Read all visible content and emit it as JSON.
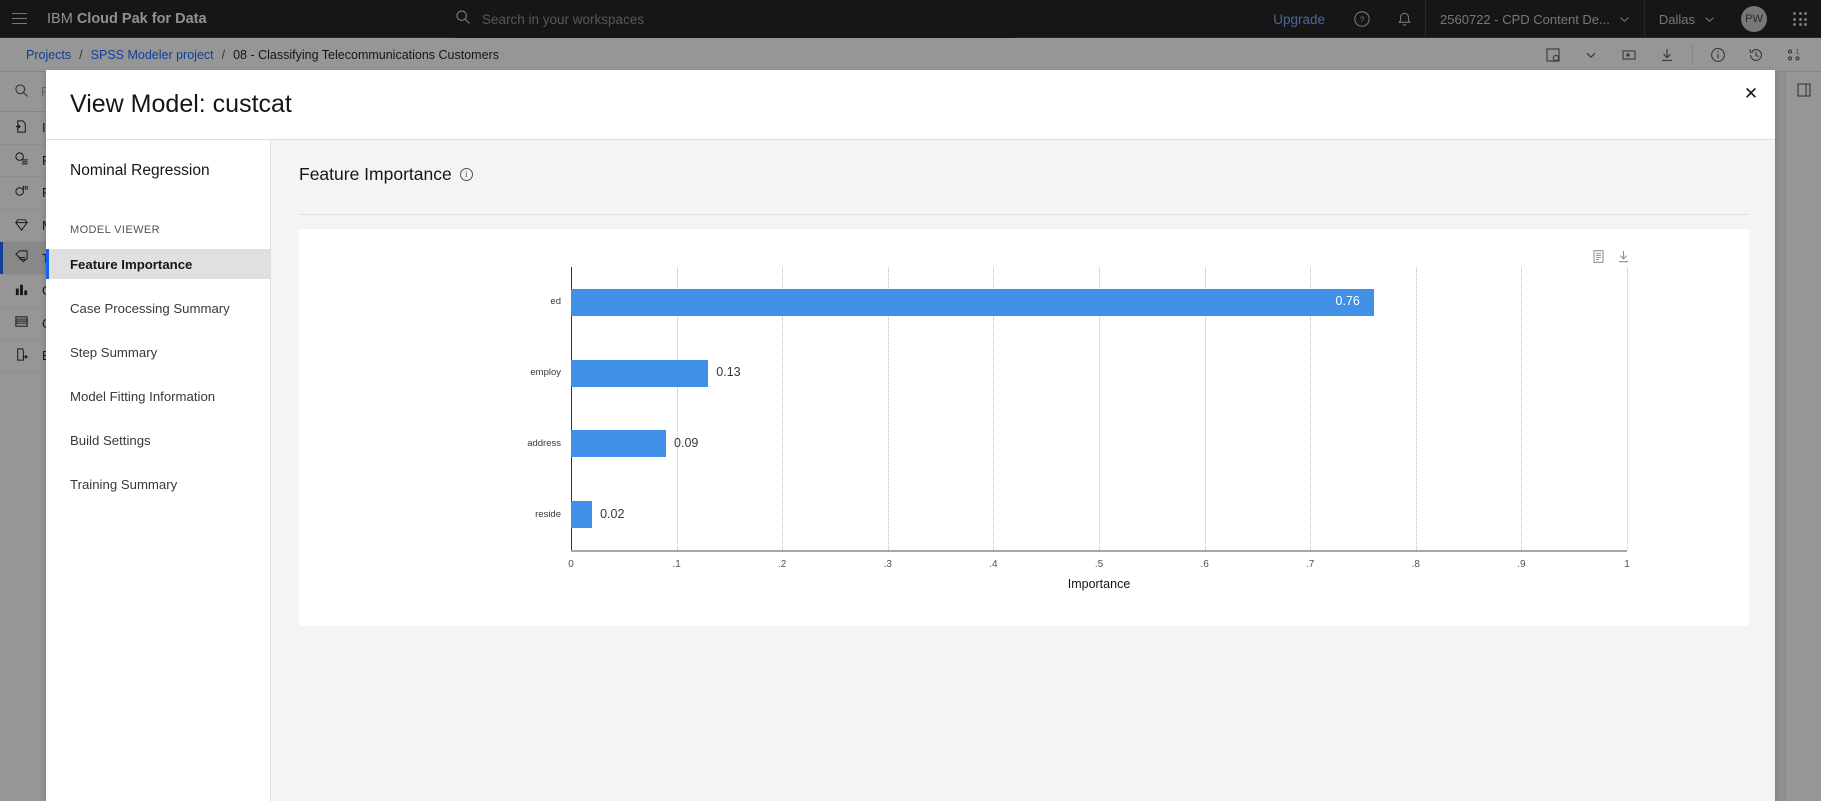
{
  "header": {
    "brand_prefix": "IBM ",
    "brand_bold": "Cloud Pak for Data",
    "search_placeholder": "Search in your workspaces",
    "upgrade_label": "Upgrade",
    "account_label": "2560722 - CPD Content De...",
    "region_label": "Dallas",
    "avatar_initials": "PW",
    "icons": {
      "menu": "hamburger-icon",
      "search": "search-icon",
      "help": "help-icon",
      "notifications": "bell-icon",
      "app_switcher": "app-switcher-icon"
    }
  },
  "breadcrumb": {
    "items": [
      {
        "label": "Projects",
        "link": true
      },
      {
        "label": "SPSS Modeler project",
        "link": true
      },
      {
        "label": "08 - Classifying Telecommunications Customers",
        "link": false
      }
    ],
    "separator": "/",
    "tools": [
      "save-icon",
      "chevron-down-icon",
      "run-icon",
      "download-icon",
      "info-icon",
      "history-icon",
      "nodes-icon"
    ]
  },
  "left_rail": {
    "search_placeholder": "Fi",
    "items": [
      {
        "label": "In",
        "icon": "import-icon",
        "selected": false
      },
      {
        "label": "Re",
        "icon": "record-ops-icon",
        "selected": false
      },
      {
        "label": "Fi",
        "icon": "field-ops-icon",
        "selected": false
      },
      {
        "label": "Mo",
        "icon": "modeling-icon",
        "selected": false
      },
      {
        "label": "Te",
        "icon": "text-analytics-icon",
        "selected": true
      },
      {
        "label": "Gr",
        "icon": "graphs-icon",
        "selected": false
      },
      {
        "label": "Ou",
        "icon": "outputs-icon",
        "selected": false
      },
      {
        "label": "Ex",
        "icon": "export-icon",
        "selected": false
      }
    ]
  },
  "modal": {
    "title": "View Model: custcat",
    "close_label": "✕",
    "nav": {
      "heading": "Nominal Regression",
      "section_label": "MODEL VIEWER",
      "items": [
        {
          "label": "Feature Importance",
          "active": true
        },
        {
          "label": "Case Processing Summary",
          "active": false
        },
        {
          "label": "Step Summary",
          "active": false
        },
        {
          "label": "Model Fitting Information",
          "active": false
        },
        {
          "label": "Build Settings",
          "active": false
        },
        {
          "label": "Training Summary",
          "active": false
        }
      ]
    },
    "content": {
      "section_title": "Feature Importance",
      "info_glyph": "i",
      "chart_tools": [
        {
          "name": "table-view-icon"
        },
        {
          "name": "download-icon"
        }
      ]
    }
  },
  "chart_data": {
    "type": "bar",
    "orientation": "horizontal",
    "title": "Feature Importance",
    "categories": [
      "ed",
      "employ",
      "address",
      "reside"
    ],
    "values": [
      0.76,
      0.13,
      0.09,
      0.02
    ],
    "value_labels": [
      "0.76",
      "0.13",
      "0.09",
      "0.02"
    ],
    "xlabel": "Importance",
    "ylabel": "",
    "xlim": [
      0,
      1
    ],
    "xticks": [
      0,
      0.1,
      0.2,
      0.3,
      0.4,
      0.5,
      0.6,
      0.7,
      0.8,
      0.9,
      1
    ],
    "xtick_labels": [
      "0",
      ".1",
      ".2",
      ".3",
      ".4",
      ".5",
      ".6",
      ".7",
      ".8",
      ".9",
      "1"
    ],
    "grid": true,
    "legend": false,
    "bar_color": "#4190e8",
    "label_inside_threshold": 0.5
  },
  "colors": {
    "brand_blue": "#0f62fe",
    "bar_blue": "#4190e8",
    "header_black": "#161616",
    "link_blue": "#78a9ff"
  }
}
